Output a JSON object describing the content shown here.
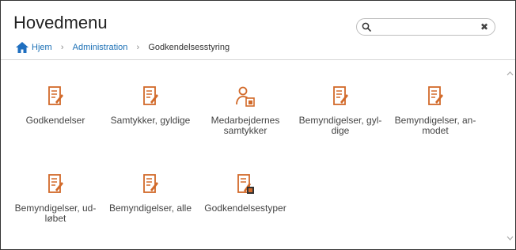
{
  "header": {
    "title": "Hovedmenu"
  },
  "search": {
    "value": "",
    "placeholder": "",
    "clear_label": "✖"
  },
  "breadcrumb": {
    "home": "Hjem",
    "admin": "Administration",
    "current": "Godkendelsesstyring",
    "separator": "›"
  },
  "tiles": [
    {
      "label": "Godkendelser",
      "icon": "document-edit-icon"
    },
    {
      "label": "Samtykker, gyldige",
      "icon": "document-edit-icon"
    },
    {
      "label": "Medarbejdernes samtykker",
      "icon": "person-document-icon"
    },
    {
      "label": "Bemyndigelser, gyl-dige",
      "icon": "document-edit-icon"
    },
    {
      "label": "Bemyndigelser, an-modet",
      "icon": "document-edit-icon"
    },
    {
      "label": "Bemyndigelser, ud-løbet",
      "icon": "document-edit-icon"
    },
    {
      "label": "Bemyndigelser, alle",
      "icon": "document-edit-icon"
    },
    {
      "label": "Godkendelsestyper",
      "icon": "document-type-icon"
    }
  ],
  "colors": {
    "accent": "#d26a2a",
    "link": "#1a6fb5",
    "home_icon": "#1f6fc0"
  }
}
